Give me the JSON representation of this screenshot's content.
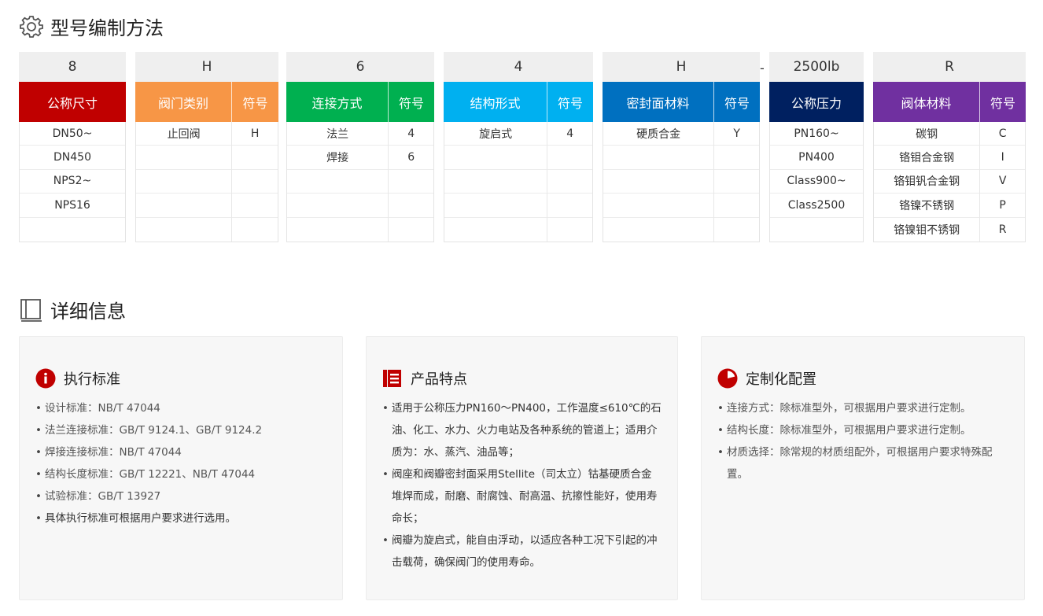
{
  "sections": {
    "model_title": "型号编制方法",
    "details_title": "详细信息"
  },
  "model": {
    "size": {
      "code": "8",
      "label": "公称尺寸",
      "color": "#c00000",
      "rows": [
        "DN50~",
        "DN450",
        "NPS2~",
        "NPS16",
        ""
      ]
    },
    "valve_type": {
      "code": "H",
      "label": "阀门类别",
      "symbol_label": "符号",
      "color": "#f79646",
      "rows": [
        [
          "止回阀",
          "H"
        ],
        [
          "",
          ""
        ],
        [
          "",
          ""
        ],
        [
          "",
          ""
        ],
        [
          "",
          ""
        ]
      ]
    },
    "connection": {
      "code": "6",
      "label": "连接方式",
      "symbol_label": "符号",
      "color": "#00b050",
      "rows": [
        [
          "法兰",
          "4"
        ],
        [
          "焊接",
          "6"
        ],
        [
          "",
          ""
        ],
        [
          "",
          ""
        ],
        [
          "",
          ""
        ]
      ]
    },
    "structure": {
      "code": "4",
      "label": "结构形式",
      "symbol_label": "符号",
      "color": "#00b0f0",
      "rows": [
        [
          "旋启式",
          "4"
        ],
        [
          "",
          ""
        ],
        [
          "",
          ""
        ],
        [
          "",
          ""
        ],
        [
          "",
          ""
        ]
      ]
    },
    "seal": {
      "code": "H",
      "label": "密封面材料",
      "symbol_label": "符号",
      "color": "#0070c0",
      "rows": [
        [
          "硬质合金",
          "Y"
        ],
        [
          "",
          ""
        ],
        [
          "",
          ""
        ],
        [
          "",
          ""
        ],
        [
          "",
          ""
        ]
      ]
    },
    "separator": "-",
    "pressure": {
      "code": "2500lb",
      "label": "公称压力",
      "color": "#002060",
      "rows": [
        "PN160~",
        "PN400",
        "Class900~",
        "Class2500",
        ""
      ]
    },
    "body_material": {
      "code": "R",
      "label": "阀体材料",
      "symbol_label": "符号",
      "color": "#7030a0",
      "rows": [
        [
          "碳钢",
          "C"
        ],
        [
          "铬钼合金钢",
          "I"
        ],
        [
          "铬钼钒合金钢",
          "V"
        ],
        [
          "铬镍不锈钢",
          "P"
        ],
        [
          "铬镍钼不锈钢",
          "R"
        ]
      ]
    }
  },
  "cards": {
    "standards": {
      "title": "执行标准",
      "icon": "info-icon",
      "items": [
        "设计标准：NB/T 47044",
        "法兰连接标准：GB/T 9124.1、GB/T 9124.2",
        "焊接连接标准：NB/T 47044",
        "结构长度标准：GB/T 12221、NB/T 47044",
        "试验标准：GB/T 13927",
        "具体执行标准可根据用户要求进行选用。"
      ]
    },
    "features": {
      "title": "产品特点",
      "icon": "document-icon",
      "items": [
        "适用于公称压力PN160～PN400，工作温度≤610℃的石油、化工、水力、火力电站及各种系统的管道上；适用介质为：水、蒸汽、油品等；",
        "阀座和阀瓣密封面采用Stellite（司太立）钴基硬质合金堆焊而成，耐磨、耐腐蚀、耐高温、抗擦性能好，使用寿命长；",
        "阀瓣为旋启式，能自由浮动，以适应各种工况下引起的冲击载荷，确保阀门的使用寿命。"
      ]
    },
    "custom": {
      "title": "定制化配置",
      "icon": "pie-chart-icon",
      "items": [
        "连接方式：除标准型外，可根据用户要求进行定制。",
        "结构长度：除标准型外，可根据用户要求进行定制。",
        "材质选择：除常规的材质组配外，可根据用户要求特殊配置。"
      ]
    }
  },
  "colors": {
    "icon_red": "#c00000"
  }
}
